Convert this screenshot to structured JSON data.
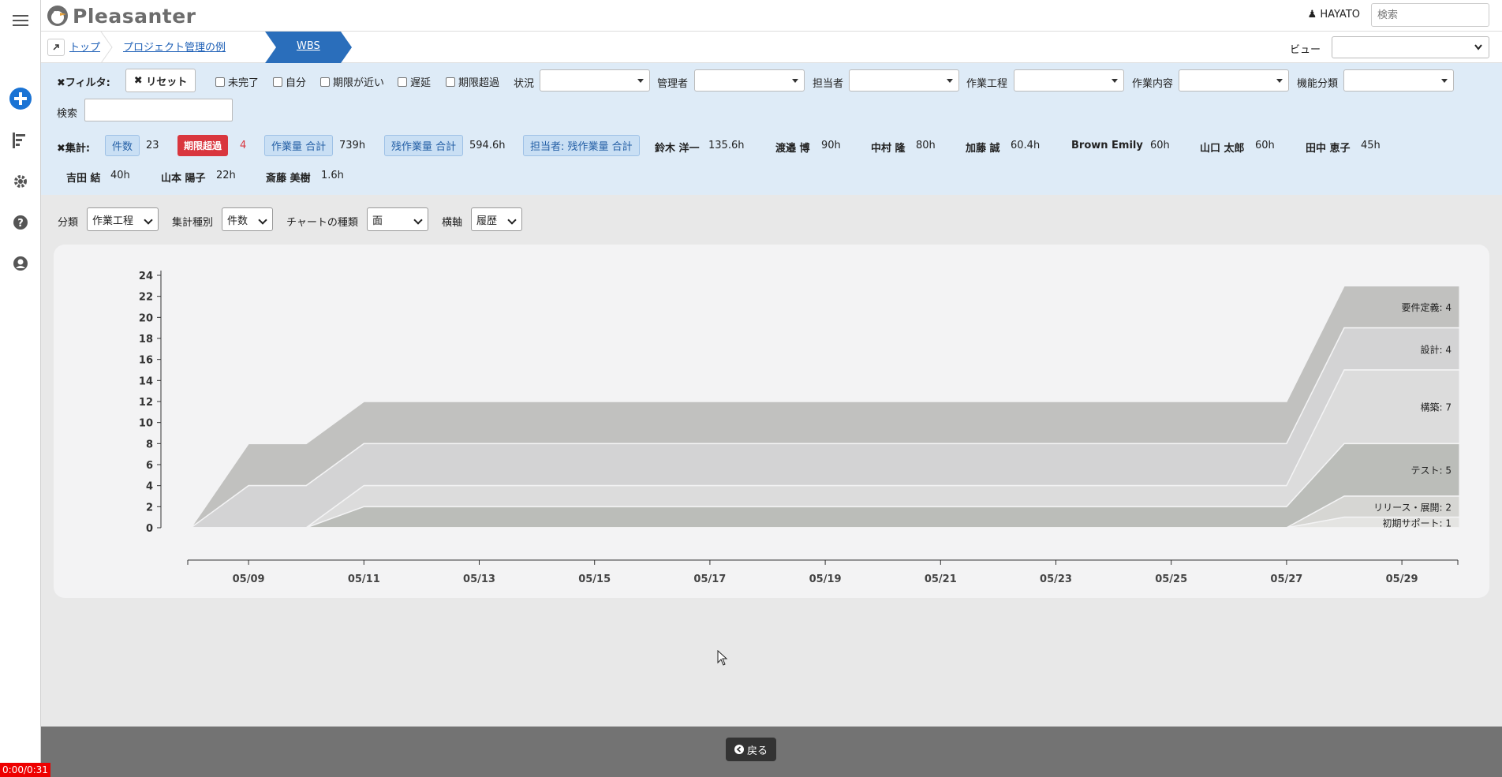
{
  "app": {
    "name": "Pleasanter"
  },
  "header": {
    "user": "HAYATO",
    "search_placeholder": "検索"
  },
  "breadcrumb": {
    "items": [
      "トップ",
      "プロジェクト管理の例",
      "WBS"
    ],
    "view_label": "ビュー"
  },
  "filters": {
    "title": "フィルタ:",
    "reset": "リセット",
    "checkboxes": [
      "未完了",
      "自分",
      "期限が近い",
      "遅延",
      "期限超過"
    ],
    "dropdowns": [
      "状況",
      "管理者",
      "担当者",
      "作業工程",
      "作業内容",
      "機能分類"
    ],
    "search_label": "検索"
  },
  "summary": {
    "title": "集計:",
    "count_label": "件数",
    "count": "23",
    "overdue_label": "期限超過",
    "overdue": "4",
    "work_total_label": "作業量 合計",
    "work_total": "739h",
    "remain_total_label": "残作業量 合計",
    "remain_total": "594.6h",
    "by_assignee_label": "担当者: 残作業量 合計",
    "people": [
      {
        "name": "鈴木 洋一",
        "value": "135.6h"
      },
      {
        "name": "渡邉 博",
        "value": "90h"
      },
      {
        "name": "中村 隆",
        "value": "80h"
      },
      {
        "name": "加藤 誠",
        "value": "60.4h"
      },
      {
        "name": "Brown Emily",
        "value": "60h"
      },
      {
        "name": "山口 太郎",
        "value": "60h"
      },
      {
        "name": "田中 恵子",
        "value": "45h"
      },
      {
        "name": "吉田 結",
        "value": "40h"
      },
      {
        "name": "山本 陽子",
        "value": "22h"
      },
      {
        "name": "斎藤 美樹",
        "value": "1.6h"
      }
    ]
  },
  "controls": {
    "category_label": "分類",
    "category_value": "作業工程",
    "agg_label": "集計種別",
    "agg_value": "件数",
    "chart_type_label": "チャートの種類",
    "chart_type_value": "面",
    "axis_label": "横軸",
    "axis_value": "履歴"
  },
  "chart_data": {
    "type": "area",
    "stacked": true,
    "ylim": [
      0,
      24
    ],
    "yticks": [
      0,
      2,
      4,
      6,
      8,
      10,
      12,
      14,
      16,
      18,
      20,
      22,
      24
    ],
    "xticks": [
      "05/09",
      "05/11",
      "05/13",
      "05/15",
      "05/17",
      "05/19",
      "05/21",
      "05/23",
      "05/25",
      "05/27",
      "05/29"
    ],
    "x": [
      "05/08",
      "05/09",
      "05/10",
      "05/11",
      "05/27",
      "05/28",
      "05/30"
    ],
    "series": [
      {
        "name": "初期サポート",
        "label": "初期サポート: 1",
        "color": "#e4e4e2",
        "values": [
          0,
          0,
          0,
          0,
          0,
          1,
          1
        ]
      },
      {
        "name": "リリース・展開",
        "label": "リリース・展開: 2",
        "color": "#d6d6d3",
        "values": [
          0,
          0,
          0,
          0,
          0,
          2,
          2
        ]
      },
      {
        "name": "テスト",
        "label": "テスト: 5",
        "color": "#bbbdb9",
        "values": [
          0,
          0,
          0,
          2,
          2,
          5,
          5
        ]
      },
      {
        "name": "構築",
        "label": "構築: 7",
        "color": "#dcdcdc",
        "values": [
          0,
          0,
          0,
          2,
          2,
          7,
          7
        ]
      },
      {
        "name": "設計",
        "label": "設計: 4",
        "color": "#d3d3d4",
        "values": [
          0,
          4,
          4,
          4,
          4,
          4,
          4
        ]
      },
      {
        "name": "要件定義",
        "label": "要件定義: 4",
        "color": "#c1c1bf",
        "values": [
          0,
          4,
          4,
          4,
          4,
          4,
          4
        ]
      }
    ]
  },
  "footer": {
    "back": "戻る",
    "timer": "0:00/0:31"
  }
}
